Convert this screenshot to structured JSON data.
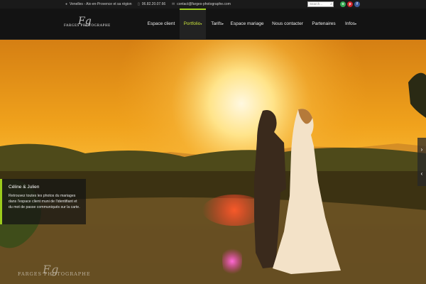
{
  "topbar": {
    "location": "Venelles - Aix-en-Provence et sa région",
    "phone": "06.82.20.07.66",
    "email": "contact@farges-photographe.com",
    "search_placeholder": "Search...",
    "location_icon": "map-pin-icon",
    "phone_icon": "phone-icon",
    "email_icon": "envelope-icon"
  },
  "social": [
    {
      "name": "tripadvisor-icon",
      "color": "#34a853",
      "glyph": "o"
    },
    {
      "name": "pinterest-icon",
      "color": "#cb2027",
      "glyph": "p"
    },
    {
      "name": "facebook-icon",
      "color": "#3b5998",
      "glyph": "f"
    }
  ],
  "logo": {
    "signature": "Fg",
    "name": "FARGES PHOTOGRAPHE"
  },
  "nav": [
    {
      "label": "Espace client",
      "has_dropdown": false
    },
    {
      "label": "Portfolio",
      "has_dropdown": true,
      "active": true
    },
    {
      "label": "Tarifs",
      "has_dropdown": true
    },
    {
      "label": "Espace mariage",
      "has_dropdown": false
    },
    {
      "label": "Nous contacter",
      "has_dropdown": false
    },
    {
      "label": "Partenaires",
      "has_dropdown": false
    },
    {
      "label": "Infos",
      "has_dropdown": true
    }
  ],
  "hero": {
    "caption_title": "Céline & Julien",
    "caption_text": "Retrouvez toutes les photos du mariages dans l'espace client muni de l'identifiant et du mot de passe communiqués sur la carte.",
    "next_icon": "chevron-right-icon",
    "prev_icon": "chevron-left-icon"
  },
  "footer_logo": {
    "signature": "Fg",
    "name": "FARGES PHOTOGRAPHE"
  },
  "colors": {
    "accent": "#9ccc1c",
    "topbar_bg": "#1a1a1a",
    "nav_bg": "#131313"
  }
}
